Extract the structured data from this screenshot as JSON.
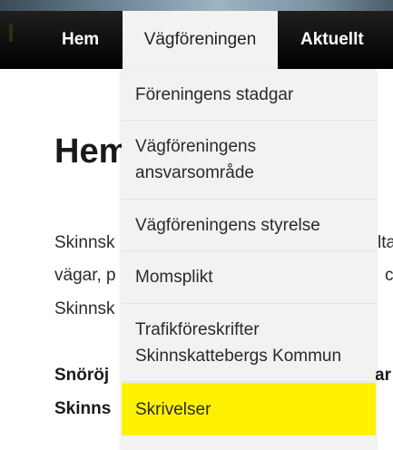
{
  "nav": {
    "items": [
      {
        "label": "Hem"
      },
      {
        "label": "Vägföreningen"
      },
      {
        "label": "Aktuellt"
      }
    ]
  },
  "dropdown": {
    "items": [
      {
        "label": "Föreningens stadgar"
      },
      {
        "label": "Vägföreningens\nansvarsområde"
      },
      {
        "label": "Vägföreningens styrelse"
      },
      {
        "label": "Momsplikt"
      },
      {
        "label": "Trafikföreskrifter\nSkinnskattebergs Kommun"
      },
      {
        "label": "Skrivelser"
      }
    ]
  },
  "content": {
    "title": "Hem",
    "para1": [
      "Skinnsk",
      "vägar, p",
      "Skinnsk"
    ],
    "para1_right": [
      "lta",
      "c"
    ],
    "para2": [
      "Snöröj",
      "Skinns"
    ],
    "para2_right": [
      "ar"
    ]
  },
  "colors": {
    "navbar": "#000000",
    "active_tab": "#f2f2f2",
    "dropdown_bg": "#f2f2f2",
    "highlight": "#fff200",
    "link": "#1a5fa8"
  }
}
